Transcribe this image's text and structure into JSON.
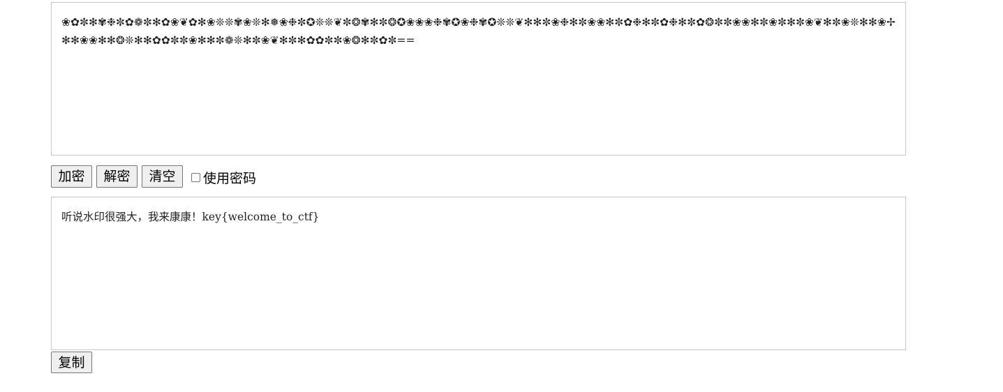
{
  "input": {
    "value": "❀✿✼✻✾❉✼✿❁✼✻✿❀❦✿✻❀❊❊✾❀❊✻❅❀❉✼✪❊❊❦✼❂✾✻✼❂✪❀❀❀❉✾✪❀❉✾✪❊❊❦✻✻✼❀❉✻✼❀❀✻✼✿❉✻✼✿❉✻✼✿❂✼✼❀❀✻✼❀✼✻✼❀❦✻✼❀❊✻✻❀✢✻✻❀❀✻✻❂❊✻✻✿✿✼✼❀✻✻✼❁❊✻✼❀❦✻✼✻✿✿✼✼❀❂✻✼✿✼=="
  },
  "toolbar": {
    "encrypt_label": "加密",
    "decrypt_label": "解密",
    "clear_label": "清空",
    "use_password_label": "使用密码",
    "use_password_checked": false
  },
  "output": {
    "value": "听说水印很强大，我来康康！key{welcome_to_ctf}"
  },
  "copy": {
    "label": "复制"
  }
}
